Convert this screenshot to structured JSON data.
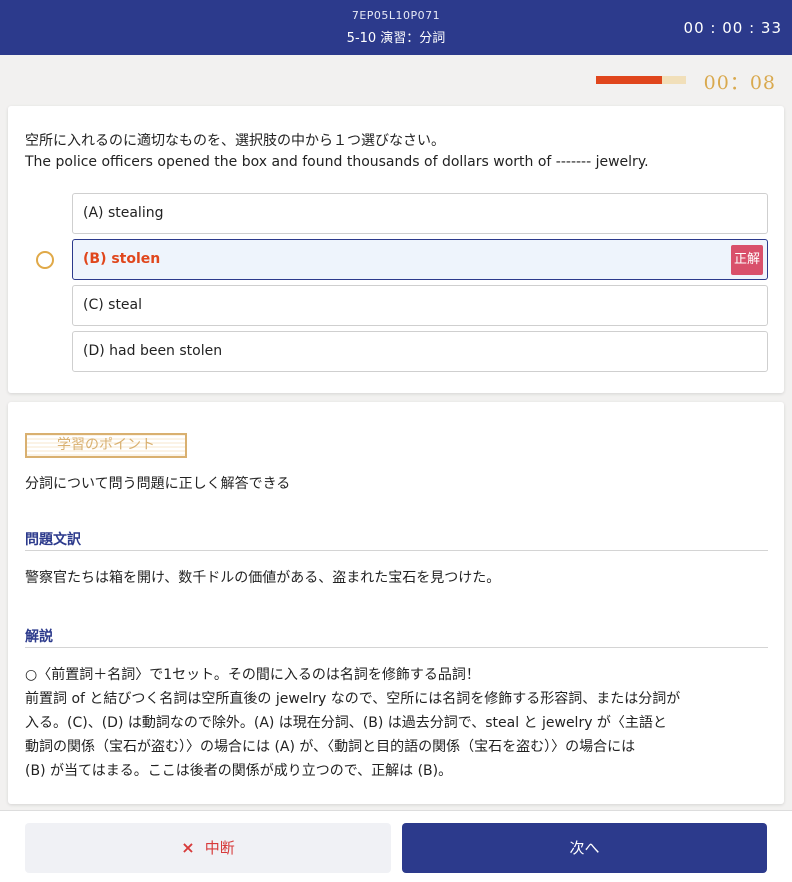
{
  "header": {
    "code": "7EP05L10P071",
    "title": "5-10 演習：分詞",
    "clock": "00 : 00 : 33"
  },
  "timer": {
    "text": "00：08",
    "progress_percent": 73,
    "bar_color": "#e0461c",
    "track_color": "#f1dfb9"
  },
  "question": {
    "instruction": "空所に入れるのに適切なものを、選択肢の中から１つ選びなさい。",
    "sentence": "The police officers opened the box and found thousands of dollars worth of ------- jewelry.",
    "choices": [
      {
        "label": "(A) stealing",
        "correct": false
      },
      {
        "label": "(B) stolen",
        "correct": true
      },
      {
        "label": "(C) steal",
        "correct": false
      },
      {
        "label": "(D) had been stolen",
        "correct": false
      }
    ],
    "correct_badge": "正解"
  },
  "explanation": {
    "point_label": "学習のポイント",
    "point_text": "分詞について問う問題に正しく解答できる",
    "translation_heading": "問題文訳",
    "translation_text": "警察官たちは箱を開け、数千ドルの価値がある、盗まれた宝石を見つけた。",
    "commentary_heading": "解説",
    "commentary_lines": [
      "○〈前置詞＋名詞〉で1セット。その間に入るのは名詞を修飾する品詞！",
      "前置詞 of と結びつく名詞は空所直後の jewelry なので、空所には名詞を修飾する形容詞、または分詞が",
      "入る。(C)、(D) は動詞なので除外。(A) は現在分詞、(B) は過去分詞で、steal と jewelry が〈主語と",
      "動詞の関係（宝石が盗む）〉の場合には (A) が、〈動詞と目的語の関係（宝石を盗む）〉の場合には",
      "(B) が当てはまる。ここは後者の関係が成り立つので、正解は (B)。"
    ]
  },
  "footer": {
    "suspend_icon": "×",
    "suspend_label": "中断",
    "next_label": "次へ"
  },
  "colors": {
    "header": "#2c3a8c",
    "accent_orange": "#e0461c",
    "gold": "#d9b070",
    "badge": "#d9506b"
  }
}
